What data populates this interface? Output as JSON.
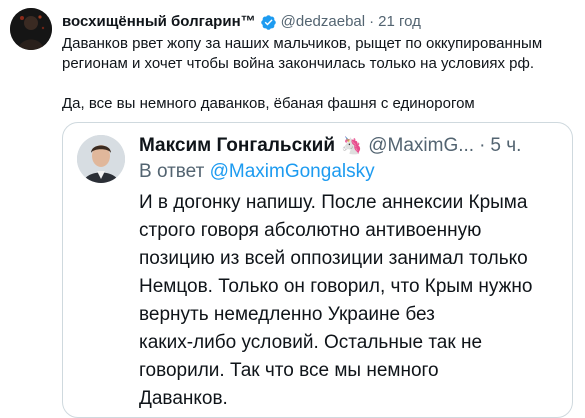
{
  "tweet": {
    "display_name": "восхищённый болгарин™",
    "handle": "@dedzaebal",
    "separator": "·",
    "time": "21 год",
    "paragraphs": [
      "Даванков рвет жопу за наших мальчиков, рыщет по оккупированным регионам и хочет чтобы война закончилась только на условиях рф.",
      "Да, все вы немного даванков, ёбаная фашня с единорогом"
    ]
  },
  "quote": {
    "display_name": "Максим Гонгальский",
    "emoji": "🦄",
    "handle": "@MaximG...",
    "separator": "·",
    "time": "5 ч.",
    "more": "···",
    "reply_prefix": "В ответ",
    "reply_handle": "@MaximGongalsky",
    "lines": [
      "И в догонку напишу. После аннексии Крыма",
      "строго говоря абсолютно антивоенную",
      "позицию из всей оппозиции занимал только",
      "Немцов. Только он говорил, что Крым нужно",
      "вернуть немедленно Украине без",
      "каких-либо условий. Остальные так не",
      "говорили. Так что все мы немного",
      "Даванков."
    ]
  },
  "colors": {
    "verified_badge": "#1d9bf0",
    "link": "#1d9bf0",
    "secondary_text": "#536471",
    "border": "#cfd9de"
  },
  "icons": {
    "verified": "verified-badge-icon",
    "avatar": "profile-avatar",
    "more": "more-options-icon"
  }
}
